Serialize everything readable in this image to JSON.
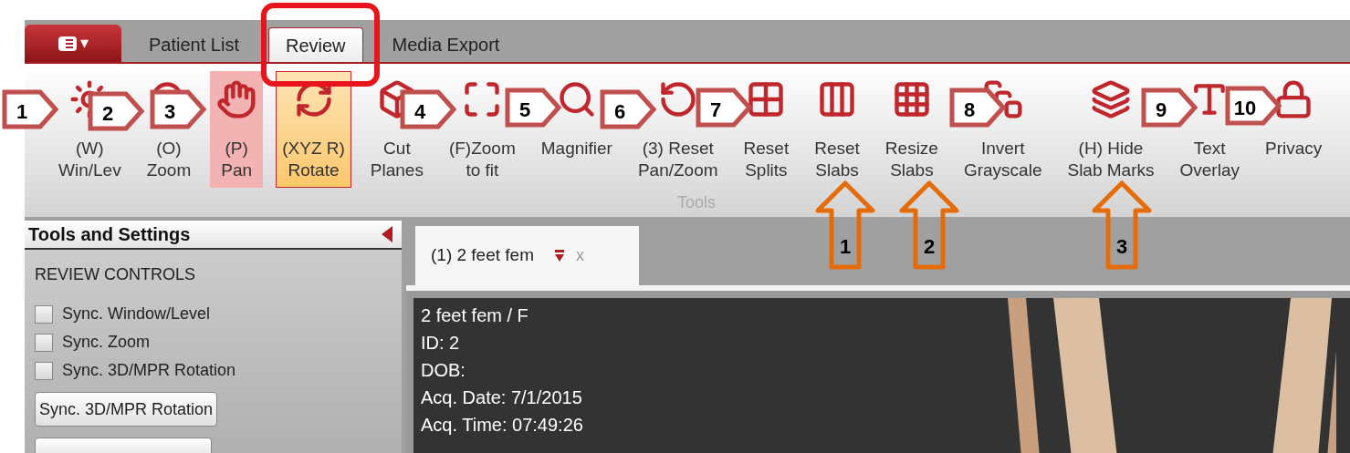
{
  "app_menu_button": {
    "caret": "▾"
  },
  "tabs": [
    {
      "label": "Patient List",
      "selected": false
    },
    {
      "label": "Review",
      "selected": true
    },
    {
      "label": "Media Export",
      "selected": false
    }
  ],
  "ribbon": {
    "group_label": "Tools",
    "tools": [
      {
        "label": [
          "(W)",
          "Win/Lev"
        ],
        "selected": false,
        "hover": false
      },
      {
        "label": [
          "(O)",
          "Zoom"
        ],
        "selected": false,
        "hover": false
      },
      {
        "label": [
          "(P)",
          "Pan"
        ],
        "selected": false,
        "hover": true
      },
      {
        "label": [
          "(XYZ R)",
          "Rotate"
        ],
        "selected": true,
        "hover": false
      },
      {
        "label": [
          "Cut",
          "Planes"
        ],
        "selected": false,
        "hover": false
      },
      {
        "label": [
          "(F)Zoom",
          "to fit"
        ],
        "selected": false,
        "hover": false
      },
      {
        "label": [
          "Magnifier"
        ],
        "selected": false,
        "hover": false
      },
      {
        "label": [
          "(3) Reset",
          "Pan/Zoom"
        ],
        "selected": false,
        "hover": false
      },
      {
        "label": [
          "Reset",
          "Splits"
        ],
        "selected": false,
        "hover": false
      },
      {
        "label": [
          "Reset",
          "Slabs"
        ],
        "selected": false,
        "hover": false
      },
      {
        "label": [
          "Resize",
          "Slabs"
        ],
        "selected": false,
        "hover": false
      },
      {
        "label": [
          "Invert",
          "Grayscale"
        ],
        "selected": false,
        "hover": false
      },
      {
        "label": [
          "(H) Hide",
          "Slab Marks"
        ],
        "selected": false,
        "hover": false
      },
      {
        "label": [
          "Text",
          "Overlay"
        ],
        "selected": false,
        "hover": false
      },
      {
        "label": [
          "Privacy"
        ],
        "selected": false,
        "hover": false
      }
    ]
  },
  "side_panel": {
    "title": "Tools and Settings",
    "section": "REVIEW CONTROLS",
    "checkboxes": [
      {
        "label": "Sync. Window/Level",
        "checked": false
      },
      {
        "label": "Sync. Zoom",
        "checked": false
      },
      {
        "label": "Sync. 3D/MPR Rotation",
        "checked": false
      }
    ],
    "buttons": [
      "Sync. 3D/MPR Rotation"
    ]
  },
  "viewer": {
    "tab": {
      "label": "(1) 2 feet fem",
      "close": "x"
    },
    "overlay_lines": [
      "2 feet fem / F",
      "ID: 2",
      "DOB:",
      "Acq. Date: 7/1/2015",
      "Acq. Time: 07:49:26"
    ]
  },
  "annotations": {
    "red_callouts": [
      "1",
      "2",
      "3",
      "4",
      "5",
      "6",
      "7",
      "8",
      "9",
      "10"
    ],
    "orange_callouts": [
      "1",
      "2",
      "3"
    ]
  }
}
